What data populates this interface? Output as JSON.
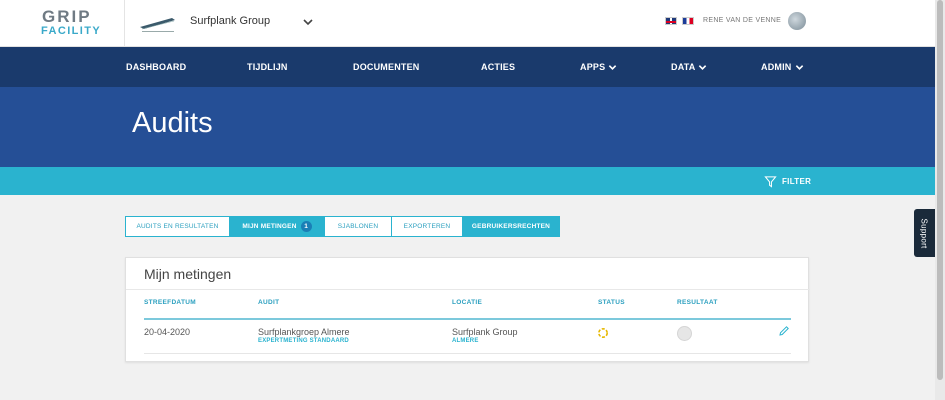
{
  "header": {
    "logo_top": "GRIP",
    "logo_bottom": "FACILITY",
    "company_name": "Surfplank Group",
    "user_name": "RENE VAN DE VENNE"
  },
  "nav": {
    "items": [
      {
        "label": "DASHBOARD"
      },
      {
        "label": "TIJDLIJN"
      },
      {
        "label": "DOCUMENTEN"
      },
      {
        "label": "ACTIES"
      },
      {
        "label": "APPS"
      },
      {
        "label": "DATA"
      },
      {
        "label": "ADMIN"
      }
    ]
  },
  "page": {
    "title": "Audits",
    "filter_label": "FILTER"
  },
  "tabs": [
    {
      "label": "AUDITS EN RESULTATEN"
    },
    {
      "label": "MIJN METINGEN",
      "badge": "1"
    },
    {
      "label": "SJABLONEN"
    },
    {
      "label": "EXPORTEREN"
    },
    {
      "label": "GEBRUIKERSRECHTEN"
    }
  ],
  "card": {
    "title": "Mijn metingen",
    "columns": [
      "STREEFDATUM",
      "AUDIT",
      "LOCATIE",
      "STATUS",
      "RESULTAAT"
    ],
    "rows": [
      {
        "streefdatum": "20-04-2020",
        "audit": "Surfplankgroep Almere",
        "audit_sub": "EXPERTMETING STANDAARD",
        "locatie": "Surfplank Group",
        "locatie_sub": "ALMERE"
      }
    ]
  },
  "support": {
    "label": "Support"
  },
  "colors": {
    "nav_bg": "#1a3a6c",
    "title_bg": "#254f96",
    "accent": "#2ab3cf",
    "status_icon": "#e6b800"
  },
  "icons": {
    "company_chevron": "chevron-down-icon",
    "filter": "filter-icon",
    "status": "status-pending-icon",
    "edit": "pencil-icon"
  }
}
